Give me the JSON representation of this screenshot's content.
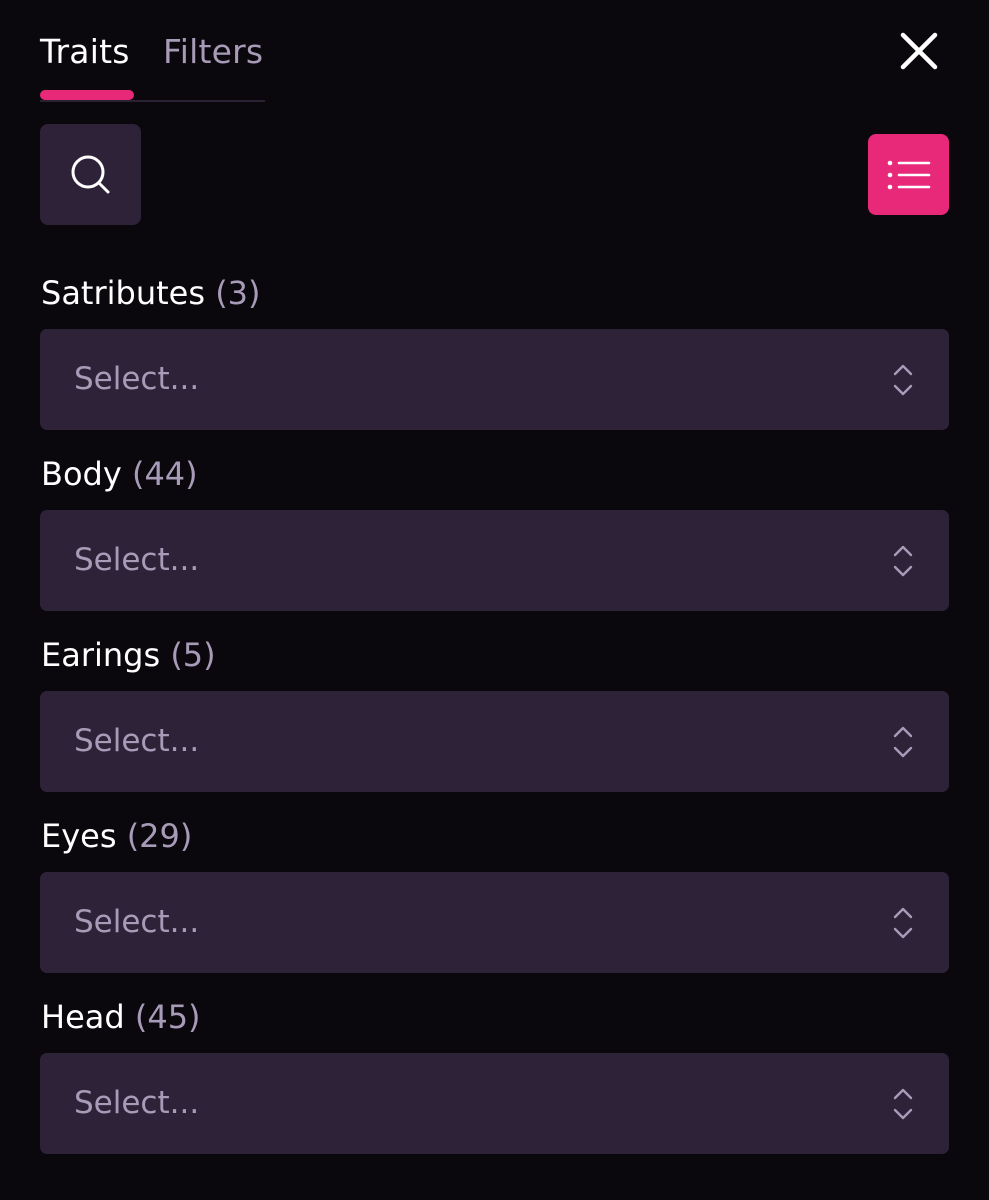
{
  "tabs": {
    "items": [
      {
        "label": "Traits",
        "active": true
      },
      {
        "label": "Filters",
        "active": false
      }
    ]
  },
  "icons": {
    "close": "close-icon",
    "search": "search-icon",
    "list": "list-icon",
    "chevron": "chevron-up-down-icon"
  },
  "colors": {
    "background": "#0a070d",
    "surface": "#2e2239",
    "accent": "#e8297a",
    "muted_text": "#a89bb8"
  },
  "trait_groups": [
    {
      "name": "Satributes",
      "count": "(3)",
      "placeholder": "Select..."
    },
    {
      "name": "Body",
      "count": "(44)",
      "placeholder": "Select..."
    },
    {
      "name": "Earings",
      "count": "(5)",
      "placeholder": "Select..."
    },
    {
      "name": "Eyes",
      "count": "(29)",
      "placeholder": "Select..."
    },
    {
      "name": "Head",
      "count": "(45)",
      "placeholder": "Select..."
    }
  ]
}
